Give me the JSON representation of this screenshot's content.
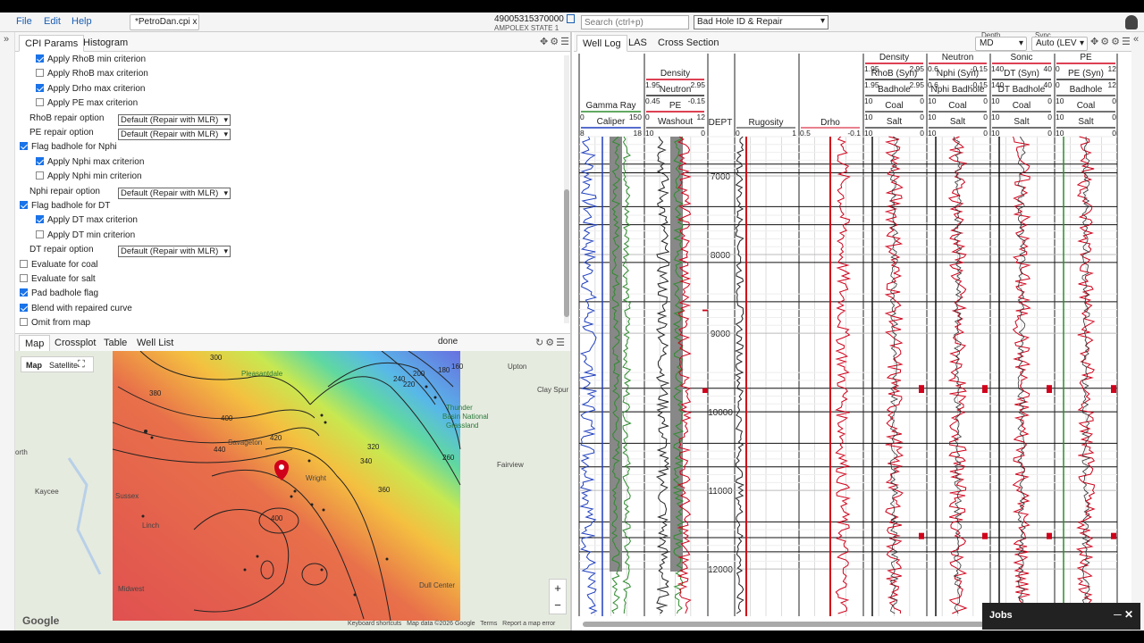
{
  "menu": {
    "file": "File",
    "edit": "Edit",
    "help": "Help"
  },
  "file_tab": "*PetroDan.cpi x",
  "well": {
    "id": "49005315370000",
    "name": "AMPOLEX STATE 1"
  },
  "search": {
    "placeholder": "Search (ctrl+p)"
  },
  "mode_select": "Bad Hole ID & Repair",
  "left_tabs": [
    "CPI Params",
    "Histogram"
  ],
  "params": [
    {
      "type": "check",
      "label": "Apply RhoB min criterion",
      "checked": true,
      "indent": 1
    },
    {
      "type": "check",
      "label": "Apply RhoB max criterion",
      "checked": false,
      "indent": 1
    },
    {
      "type": "check",
      "label": "Apply Drho max criterion",
      "checked": true,
      "indent": 1
    },
    {
      "type": "check",
      "label": "Apply PE max criterion",
      "checked": false,
      "indent": 1
    },
    {
      "type": "select",
      "label": "RhoB repair option",
      "value": "Default (Repair with MLR)"
    },
    {
      "type": "select",
      "label": "PE repair option",
      "value": "Default (Repair with MLR)"
    },
    {
      "type": "check",
      "label": "Flag badhole for Nphi",
      "checked": true,
      "indent": 0
    },
    {
      "type": "check",
      "label": "Apply Nphi max criterion",
      "checked": true,
      "indent": 1
    },
    {
      "type": "check",
      "label": "Apply Nphi min criterion",
      "checked": false,
      "indent": 1
    },
    {
      "type": "select",
      "label": "Nphi repair option",
      "value": "Default (Repair with MLR)"
    },
    {
      "type": "check",
      "label": "Flag badhole for DT",
      "checked": true,
      "indent": 0
    },
    {
      "type": "check",
      "label": "Apply DT max criterion",
      "checked": true,
      "indent": 1
    },
    {
      "type": "check",
      "label": "Apply DT min criterion",
      "checked": false,
      "indent": 1
    },
    {
      "type": "select",
      "label": "DT repair option",
      "value": "Default (Repair with MLR)"
    },
    {
      "type": "check",
      "label": "Evaluate for coal",
      "checked": false,
      "indent": 0
    },
    {
      "type": "check",
      "label": "Evaluate for salt",
      "checked": false,
      "indent": 0
    },
    {
      "type": "check",
      "label": "Pad badhole flag",
      "checked": true,
      "indent": 0
    },
    {
      "type": "check",
      "label": "Blend with repaired curve",
      "checked": true,
      "indent": 0
    },
    {
      "type": "check",
      "label": "Omit from map",
      "checked": false,
      "indent": 0
    }
  ],
  "map_tabs": [
    "Map",
    "Crossplot",
    "Table",
    "Well List"
  ],
  "map_status": "done",
  "map": {
    "toggle": [
      "Map",
      "Satellite"
    ],
    "places": [
      "Upton",
      "Clay Spur",
      "Thunder",
      "Basin National",
      "Grassland",
      "Pleasantdale",
      "Savageton",
      "Wright",
      "Fairview",
      "Kaycee",
      "Sussex",
      "Linch",
      "Midwest",
      "Dull Center",
      "orth"
    ],
    "contours": [
      "300",
      "380",
      "400",
      "420",
      "440",
      "320",
      "340",
      "260",
      "360",
      "220",
      "240",
      "200",
      "180",
      "160",
      "400"
    ],
    "footer": [
      "Keyboard shortcuts",
      "Map data ©2026 Google",
      "Terms",
      "Report a map error"
    ],
    "logo": "Google",
    "zoom_in": "+",
    "zoom_out": "−"
  },
  "right_tabs": [
    "Well Log",
    "LAS",
    "Cross Section"
  ],
  "depth": {
    "label": "Depth",
    "value": "MD"
  },
  "sync": {
    "label": "Sync",
    "value": "Auto (LEV"
  },
  "tracks": {
    "t1": {
      "names": [
        "Gamma Ray",
        "Caliper"
      ],
      "scales": [
        [
          "0",
          "150"
        ],
        [
          "8",
          "18"
        ]
      ]
    },
    "t2": {
      "names": [
        "Density",
        "Neutron",
        "PE",
        "Washout"
      ],
      "scales": [
        [
          "1.95",
          "2.95"
        ],
        [
          "0.45",
          "-0.15"
        ],
        [
          "0",
          "12"
        ],
        [
          "10",
          "0"
        ]
      ]
    },
    "dept": "DEPT",
    "t4": {
      "name": "Rugosity",
      "scale": [
        "0",
        "1"
      ]
    },
    "t5": {
      "name": "Drho",
      "scale": [
        "0.5",
        "-0.1"
      ]
    },
    "t6": {
      "names": [
        "Density",
        "RhoB (Syn)",
        "Badhole",
        "Coal",
        "Salt"
      ],
      "scales": [
        [
          "1.95",
          "2.95"
        ],
        [
          "1.95",
          "2.95"
        ],
        [
          "10",
          "0"
        ],
        [
          "10",
          "0"
        ],
        [
          "10",
          "0"
        ]
      ]
    },
    "t7": {
      "names": [
        "Neutron",
        "Nphi (Syn)",
        "Nphi Badhole",
        "Coal",
        "Salt"
      ],
      "scales": [
        [
          "0.6",
          "-0.15"
        ],
        [
          "0.6",
          "-0.15"
        ],
        [
          "10",
          "0"
        ],
        [
          "10",
          "0"
        ],
        [
          "10",
          "0"
        ]
      ]
    },
    "t8": {
      "names": [
        "Sonic",
        "DT (Syn)",
        "DT Badhole",
        "Coal",
        "Salt"
      ],
      "scales": [
        [
          "140",
          "40"
        ],
        [
          "140",
          "40"
        ],
        [
          "10",
          "0"
        ],
        [
          "10",
          "0"
        ],
        [
          "10",
          "0"
        ]
      ]
    },
    "t9": {
      "names": [
        "PE",
        "PE (Syn)",
        "Badhole",
        "Coal",
        "Salt"
      ],
      "scales": [
        [
          "0",
          "12"
        ],
        [
          "0",
          "12"
        ],
        [
          "10",
          "0"
        ],
        [
          "10",
          "0"
        ],
        [
          "10",
          "0"
        ]
      ]
    }
  },
  "depth_ticks": [
    "7000",
    "8000",
    "9000",
    "10000",
    "11000",
    "12000"
  ],
  "jobs": "Jobs",
  "colors": {
    "accent": "#1a5fb4",
    "curve_red": "#d0021b",
    "curve_green": "#2e8b2e",
    "curve_blue": "#1f3fbf"
  }
}
